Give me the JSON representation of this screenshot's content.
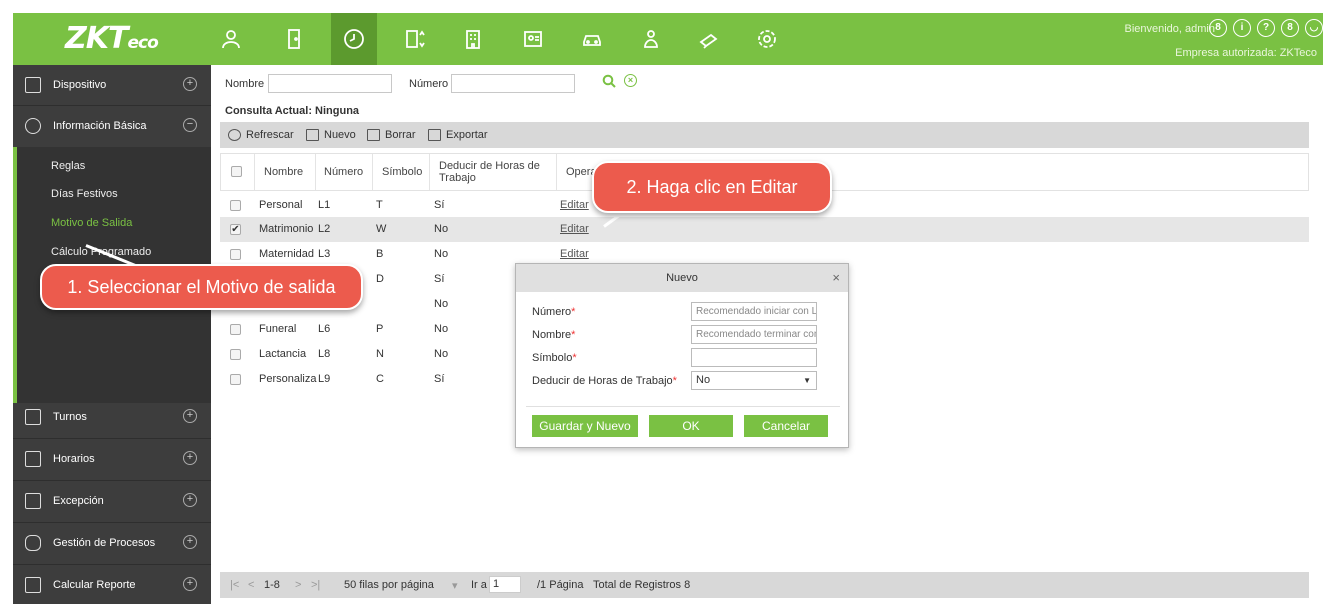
{
  "header": {
    "logo_main": "ZKT",
    "logo_suffix": "eco",
    "welcome": "Bienvenido, admin",
    "company": "Empresa autorizada: ZKTeco",
    "nav_icons": [
      "person-icon",
      "door-icon",
      "clock-icon",
      "elevator-icon",
      "building-icon",
      "visitor-icon",
      "car-icon",
      "patrol-icon",
      "camera-icon",
      "settings-icon"
    ],
    "right_icons": [
      "user-circle-icon",
      "info-icon",
      "help-icon",
      "account-icon",
      "power-icon"
    ]
  },
  "sidebar": {
    "sections": [
      {
        "label": "Dispositivo",
        "toggle": "+"
      },
      {
        "label": "Información Básica",
        "toggle": "−"
      },
      {
        "label": "Turnos",
        "toggle": "+"
      },
      {
        "label": "Horarios",
        "toggle": "+"
      },
      {
        "label": "Excepción",
        "toggle": "+"
      },
      {
        "label": "Gestión de Procesos",
        "toggle": "+"
      },
      {
        "label": "Calcular Reporte",
        "toggle": "+"
      }
    ],
    "sub_items": [
      "Reglas",
      "Días Festivos",
      "Motivo de Salida",
      "Cálculo Programado"
    ]
  },
  "filter": {
    "nombre_label": "Nombre",
    "numero_label": "Número",
    "consulta": "Consulta Actual: Ninguna"
  },
  "toolbar": {
    "refresh": "Refrescar",
    "new": "Nuevo",
    "delete": "Borrar",
    "export": "Exportar"
  },
  "table": {
    "columns": [
      "Nombre",
      "Número",
      "Símbolo",
      "Deducir de Horas de Trabajo",
      "Operac"
    ],
    "rows": [
      {
        "nombre": "Personal",
        "numero": "L1",
        "simbolo": "T",
        "deducir": "Sí",
        "op": "Editar",
        "checked": ""
      },
      {
        "nombre": "Matrimonio",
        "numero": "L2",
        "simbolo": "W",
        "deducir": "No",
        "op": "Editar",
        "checked": "✔"
      },
      {
        "nombre": "Maternidad",
        "numero": "L3",
        "simbolo": "B",
        "deducir": "No",
        "op": "Editar",
        "checked": ""
      },
      {
        "nombre": "",
        "numero": "",
        "simbolo": "D",
        "deducir": "Sí",
        "op": "",
        "checked": ""
      },
      {
        "nombre": "",
        "numero": "",
        "simbolo": "",
        "deducir": "No",
        "op": "",
        "checked": ""
      },
      {
        "nombre": "Funeral",
        "numero": "L6",
        "simbolo": "P",
        "deducir": "No",
        "op": "",
        "checked": ""
      },
      {
        "nombre": "Lactancia",
        "numero": "L8",
        "simbolo": "N",
        "deducir": "No",
        "op": "",
        "checked": ""
      },
      {
        "nombre": "Personaliza",
        "numero": "L9",
        "simbolo": "C",
        "deducir": "Sí",
        "op": "",
        "checked": ""
      }
    ]
  },
  "pager": {
    "first": "|<",
    "prev": "<",
    "range": "1-8",
    "next": ">",
    "last": ">|",
    "per_page": "50 filas por página",
    "goto": "Ir a",
    "page": "1",
    "pages": "/1 Página",
    "total": "Total de Registros 8"
  },
  "dialog": {
    "title": "Nuevo",
    "close": "×",
    "numero_label": "Número",
    "nombre_label": "Nombre",
    "simbolo_label": "Símbolo",
    "deducir_label": "Deducir de Horas de Trabajo",
    "req": "*",
    "numero_placeholder": "Recomendado iniciar con L",
    "nombre_placeholder": "Recomendado terminar con",
    "deducir_value": "No",
    "save_new": "Guardar y Nuevo",
    "ok": "OK",
    "cancel": "Cancelar"
  },
  "callouts": {
    "step1": "1. Seleccionar el Motivo de salida",
    "step2": "2. Haga clic en Editar"
  },
  "colors": {
    "accent": "#7ac143",
    "sidebar": "#3d3d3d",
    "callout": "#ec5b4d"
  }
}
